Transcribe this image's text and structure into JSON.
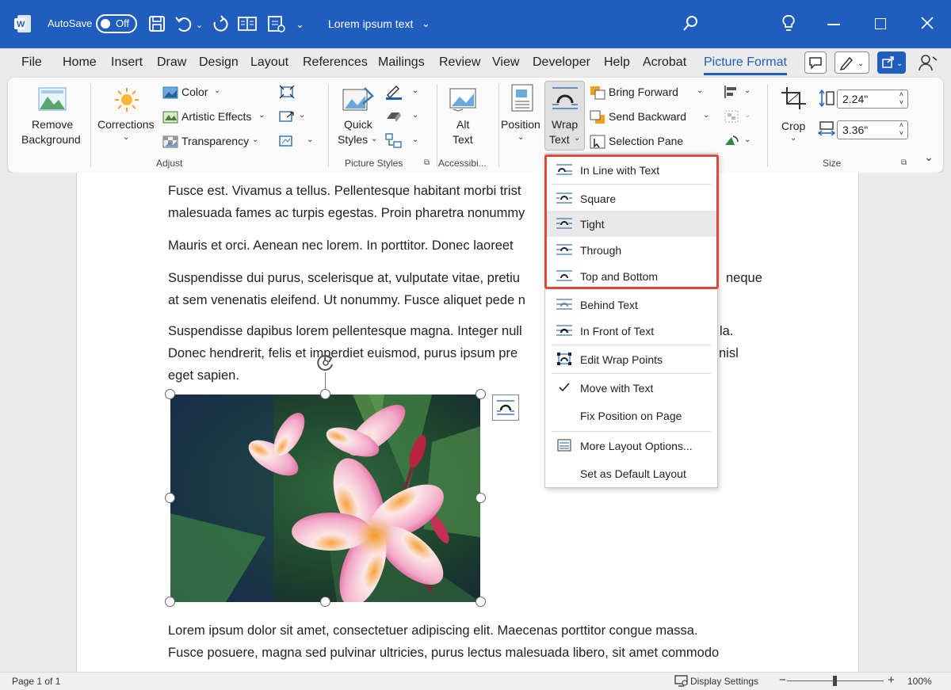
{
  "titlebar": {
    "autosave_label": "AutoSave",
    "autosave_state": "Off",
    "doc_title": "Lorem ipsum text",
    "accent": "#1f5dbf"
  },
  "tabs": [
    "File",
    "Home",
    "Insert",
    "Draw",
    "Design",
    "Layout",
    "References",
    "Mailings",
    "Review",
    "View",
    "Developer",
    "Help",
    "Acrobat",
    "Picture Format"
  ],
  "active_tab": "Picture Format",
  "ribbon": {
    "remove_bg": [
      "Remove",
      "Background"
    ],
    "corrections": "Corrections",
    "color": "Color",
    "artistic": "Artistic Effects",
    "transparency": "Transparency",
    "adjust": "Adjust",
    "quick_styles": [
      "Quick",
      "Styles"
    ],
    "picture_styles": "Picture Styles",
    "alt_text": [
      "Alt",
      "Text"
    ],
    "accessibility": "Accessibi...",
    "position": "Position",
    "wrap_text": [
      "Wrap",
      "Text"
    ],
    "bring_forward": "Bring Forward",
    "send_backward": "Send Backward",
    "selection_pane": "Selection Pane",
    "crop": "Crop",
    "height": "2.24\"",
    "width": "3.36\"",
    "size": "Size"
  },
  "paragraphs": [
    "Fusce est. Vivamus a tellus. Pellentesque habitant morbi trist",
    "malesuada fames ac turpis egestas. Proin pharetra nonummy",
    "Mauris et orci. Aenean nec lorem. In porttitor. Donec laoreet",
    "Suspendisse dui purus, scelerisque at, vulputate vitae, pretiu",
    "neque",
    "at sem venenatis eleifend. Ut nonummy. Fusce aliquet pede n",
    "Suspendisse dapibus lorem pellentesque magna. Integer null",
    "la.",
    "Donec hendrerit, felis et imperdiet euismod, purus ipsum pre",
    "nisl",
    "eget sapien.",
    "Lorem ipsum dolor sit amet, consectetuer adipiscing elit. Maecenas porttitor congue massa.",
    "Fusce posuere, magna sed pulvinar ultricies, purus lectus malesuada libero, sit amet commodo"
  ],
  "wrap_menu": {
    "items": [
      "In Line with Text",
      "Square",
      "Tight",
      "Through",
      "Top and Bottom",
      "Behind Text",
      "In Front of Text",
      "Edit Wrap Points",
      "Move with Text",
      "Fix Position on Page",
      "More Layout Options...",
      "Set as Default Layout"
    ],
    "hovered": "Tight",
    "checked": "Move with Text",
    "highlight_color": "#e0483e"
  },
  "status": {
    "page": "Page 1 of 1",
    "display_settings": "Display Settings",
    "zoom": "100%",
    "minus": "−",
    "plus": "+"
  }
}
